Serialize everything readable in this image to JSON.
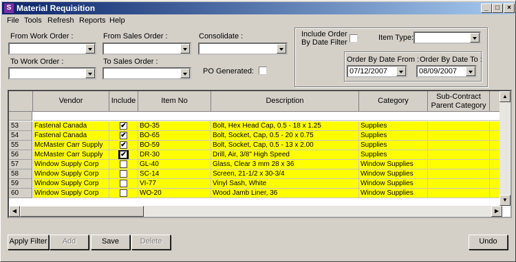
{
  "window": {
    "title": "Material Requisition",
    "app_icon": "S",
    "controls": {
      "minimize": "_",
      "maximize": "□",
      "close": "×"
    }
  },
  "menu": [
    "File",
    "Tools",
    "Refresh",
    "Reports",
    "Help"
  ],
  "filters": {
    "from_work_order": {
      "label": "From Work Order :",
      "value": ""
    },
    "to_work_order": {
      "label": "To Work Order :",
      "value": ""
    },
    "from_sales_order": {
      "label": "From Sales Order :",
      "value": ""
    },
    "to_sales_order": {
      "label": "To Sales Order :",
      "value": ""
    },
    "consolidate": {
      "label": "Consolidate :",
      "value": ""
    },
    "po_generated": {
      "label": "PO Generated:",
      "checked": false
    },
    "include_order_by_date": {
      "label_line1": "Include Order",
      "label_line2": "By Date Filter",
      "checked": false
    },
    "item_type": {
      "label": "Item Type:",
      "value": ""
    },
    "order_by_date_from": {
      "label": "Order By Date From :",
      "value": "07/12/2007"
    },
    "order_by_date_to": {
      "label": "Order By Date To :",
      "value": "08/09/2007"
    }
  },
  "grid": {
    "columns": [
      "Vendor",
      "Include",
      "Item No",
      "Description",
      "Category",
      "Sub-Contract Parent Category"
    ],
    "rows": [
      {
        "num": "53",
        "vendor": "Fastenal Canada",
        "include": true,
        "item_no": "BO-35",
        "description": "Bolt, Hex Head Cap, 0.5 - 18 x 1.25",
        "category": "Supplies"
      },
      {
        "num": "54",
        "vendor": "Fastenal Canada",
        "include": true,
        "item_no": "BO-65",
        "description": "Bolt, Socket, Cap, 0.5 - 20 x 0.75",
        "category": "Supplies"
      },
      {
        "num": "55",
        "vendor": "McMaster Carr Supply",
        "include": true,
        "item_no": "BO-59",
        "description": "Bolt, Socket, Cap, 0.5 - 13 x 2.00",
        "category": "Supplies"
      },
      {
        "num": "56",
        "vendor": "McMaster Carr Supply",
        "include": true,
        "item_no": "DR-30",
        "description": "Drill, Air, 3/8\" High Speed",
        "category": "Supplies"
      },
      {
        "num": "57",
        "vendor": "Window Supply Corp",
        "include": false,
        "item_no": "GL-40",
        "description": "Glass, Clear 3 mm 28 x 36",
        "category": "Window Supplies"
      },
      {
        "num": "58",
        "vendor": "Window Supply Corp",
        "include": false,
        "item_no": "SC-14",
        "description": "Screen, 21-1/2 x 30-3/4",
        "category": "Window Supplies"
      },
      {
        "num": "59",
        "vendor": "Window Supply Corp",
        "include": false,
        "item_no": "VI-77",
        "description": "Vinyl Sash, White",
        "category": "Window Supplies"
      },
      {
        "num": "60",
        "vendor": "Window Supply Corp",
        "include": false,
        "item_no": "WO-20",
        "description": "Wood Jamb Liner, 36",
        "category": "Window Supplies"
      }
    ],
    "check_glyph": "✔"
  },
  "buttons": {
    "apply_filter": "Apply Filter",
    "add": "Add",
    "save": "Save",
    "delete": "Delete",
    "undo": "Undo"
  },
  "colors": {
    "row_highlight": "#ffff00",
    "title_gradient_start": "#0a246a"
  }
}
